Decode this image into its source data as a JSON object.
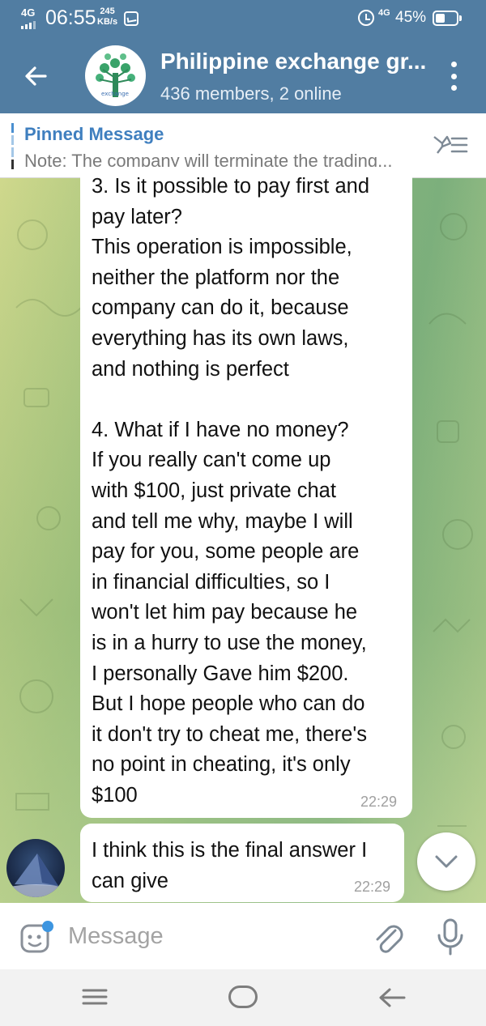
{
  "status_bar": {
    "network": "4G",
    "time": "06:55",
    "speed_value": "245",
    "speed_unit": "KB/s",
    "network2": "4G",
    "battery_percent": "45%",
    "battery_level": 0.45
  },
  "header": {
    "title": "Philippine exchange gr...",
    "subtitle": "436 members, 2 online",
    "avatar_icon": "tree-logo",
    "avatar_label": "exchange"
  },
  "pinned": {
    "label": "Pinned Message",
    "text": "Note: The company will terminate the trading..."
  },
  "messages": [
    {
      "text": "3. Is it possible to pay first and\npay later?\nThis operation is impossible,\nneither the platform nor the\ncompany can do it, because\neverything has its own laws,\nand nothing is perfect\n\n4. What if I have no money?\nIf you really can't come up\nwith $100, just private chat\nand tell me why, maybe I will\npay for you, some people are\nin financial difficulties, so I\nwon't let him pay because he\nis in a hurry to use the money,\nI personally Gave him $200.\nBut I hope people who can do\nit don't try to cheat me, there's\nno point in cheating, it's only\n$100",
      "time": "22:29"
    },
    {
      "text": "I think this is the final answer I can give",
      "time": "22:29"
    }
  ],
  "input": {
    "placeholder": "Message"
  },
  "colors": {
    "header": "#517da2",
    "accent": "#3f7fbf"
  }
}
